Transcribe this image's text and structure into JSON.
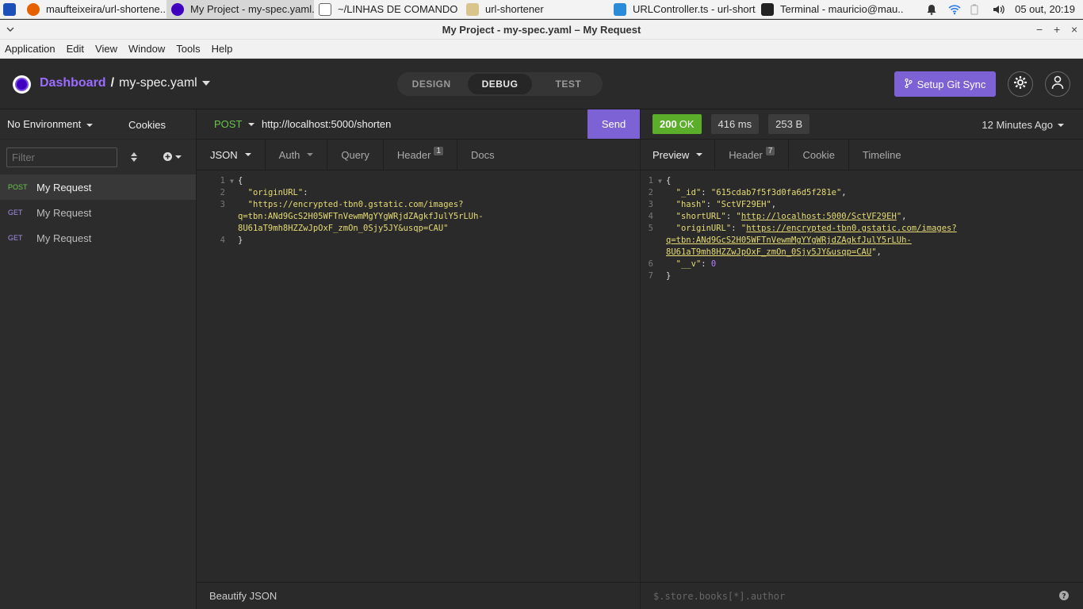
{
  "taskbar": {
    "apps": [
      {
        "label": "maufteixeira/url-shortene...",
        "icon": "firefox-icon",
        "color": "#e66000"
      },
      {
        "label": "My Project - my-spec.yaml...",
        "icon": "insomnia-icon",
        "color": "#4000bf"
      },
      {
        "label": "~/LINHAS DE COMANDO ...",
        "icon": "text-editor-icon",
        "color": "#666666"
      },
      {
        "label": "url-shortener",
        "icon": "folder-icon",
        "color": "#c9a65a"
      },
      {
        "label": "URLController.ts - url-short...",
        "icon": "vscode-icon",
        "color": "#2a8cd8"
      },
      {
        "label": "Terminal - mauricio@mau...",
        "icon": "terminal-icon",
        "color": "#222222"
      }
    ],
    "clock": "05 out, 20:19"
  },
  "window": {
    "title": "My Project - my-spec.yaml – My Request",
    "minimize": "−",
    "maximize": "+",
    "close": "×"
  },
  "menu": [
    "Application",
    "Edit",
    "View",
    "Window",
    "Tools",
    "Help"
  ],
  "header": {
    "dashboard": "Dashboard",
    "separator": "/",
    "spec": "my-spec.yaml",
    "modes": [
      "DESIGN",
      "DEBUG",
      "TEST"
    ],
    "active_mode": "DEBUG",
    "git_sync": "Setup Git Sync"
  },
  "sidebar": {
    "environment": "No Environment",
    "cookies": "Cookies",
    "filter_placeholder": "Filter",
    "requests": [
      {
        "method": "POST",
        "name": "My Request"
      },
      {
        "method": "GET",
        "name": "My Request"
      },
      {
        "method": "GET",
        "name": "My Request"
      }
    ]
  },
  "request": {
    "method": "POST",
    "url": "http://localhost:5000/shorten",
    "send": "Send",
    "tabs": {
      "body": "JSON",
      "auth": "Auth",
      "query": "Query",
      "header": "Header",
      "header_count": "1",
      "docs": "Docs"
    },
    "body_lines": {
      "l1": "{",
      "l2_key": "\"originURL\"",
      "l2_colon": ":",
      "l3": "\"https://encrypted-tbn0.gstatic.com/images?",
      "l3b": "q=tbn:ANd9GcS2H05WFTnVewmMgYYgWRjdZAgkfJulY5rLUh-",
      "l3c": "8U61aT9mh8HZZwJpOxF_zmOn_0Sjy5JY&usqp=CAU\"",
      "l4": "}"
    },
    "line_numbers": [
      "1",
      "2",
      "3",
      "4"
    ],
    "footer": "Beautify JSON"
  },
  "response": {
    "status_code": "200",
    "status_text": "OK",
    "time": "416 ms",
    "size": "253 B",
    "ago": "12 Minutes Ago",
    "tabs": {
      "preview": "Preview",
      "header": "Header",
      "header_count": "7",
      "cookie": "Cookie",
      "timeline": "Timeline"
    },
    "line_numbers": [
      "1",
      "2",
      "3",
      "4",
      "5",
      "6",
      "7"
    ],
    "body": {
      "open": "{",
      "id_key": "\"_id\"",
      "id_val": "\"615cdab7f5f3d0fa6d5f281e\"",
      "hash_key": "\"hash\"",
      "hash_val": "\"SctVF29EH\"",
      "short_key": "\"shortURL\"",
      "short_val": "http://localhost:5000/SctVF29EH",
      "origin_key": "\"originURL\"",
      "origin_val_a": "https://encrypted-tbn0.gstatic.com/images?",
      "origin_val_b": "q=tbn:ANd9GcS2H05WFTnVewmMgYYgWRjdZAgkfJulY5rLUh-",
      "origin_val_c": "8U61aT9mh8HZZwJpOxF_zmOn_0Sjy5JY&usqp=CAU",
      "v_key": "\"__v\"",
      "v_val": "0",
      "close": "}"
    },
    "filter_placeholder": "$.store.books[*].author"
  }
}
